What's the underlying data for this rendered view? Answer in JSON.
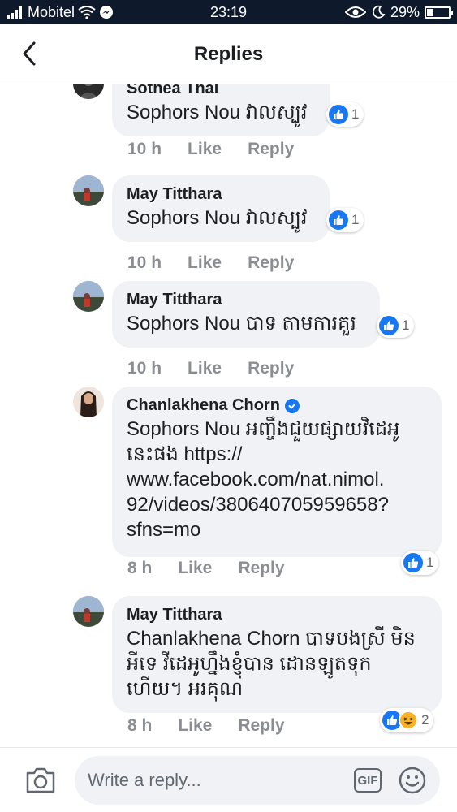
{
  "status_bar": {
    "carrier": "Mobitel",
    "time": "23:19",
    "battery": "29%",
    "battery_level": 0.29
  },
  "header": {
    "title": "Replies"
  },
  "comments": [
    {
      "author": "Sothea Thai",
      "text": "Sophors Nou វាលស្បូវ",
      "time": "10 h",
      "like_label": "Like",
      "reply_label": "Reply",
      "reaction_count": "1",
      "reactions": [
        "like-icon"
      ]
    },
    {
      "author": "May Titthara",
      "text": "Sophors Nou វាលស្បូវ",
      "time": "10 h",
      "like_label": "Like",
      "reply_label": "Reply",
      "reaction_count": "1",
      "reactions": [
        "like-icon"
      ]
    },
    {
      "author": "May Titthara",
      "text": "Sophors Nou បាទ តាមការគួរ",
      "time": "10 h",
      "like_label": "Like",
      "reply_label": "Reply",
      "reaction_count": "1",
      "reactions": [
        "like-icon"
      ]
    },
    {
      "author": "Chanlakhena Chorn",
      "verified": true,
      "text_lines": [
        "Sophors Nou  អញ្ចឹងជួយផ្សាយវិដេអូ",
        "នេះផង https://",
        "www.facebook.com/nat.nimol.",
        "92/videos/380640705959658?",
        "sfns=mo"
      ],
      "time": "8 h",
      "like_label": "Like",
      "reply_label": "Reply",
      "reaction_count": "1",
      "reactions": [
        "like-icon"
      ]
    },
    {
      "author": "May Titthara",
      "text_lines": [
        "Chanlakhena Chorn បាទបងស្រី មិន",
        "អីទេ វីដេអូហ្នឹងខ្ញុំបាន ដោនឡូតទុក",
        "ហើយ។ អរគុណ"
      ],
      "time": "8 h",
      "like_label": "Like",
      "reply_label": "Reply",
      "reaction_count": "2",
      "reactions": [
        "like-icon",
        "haha-icon"
      ]
    }
  ],
  "composer": {
    "placeholder": "Write a reply...",
    "gif_label": "GIF"
  },
  "colors": {
    "accent": "#1877f2",
    "status_bar": "#0e1a2b",
    "bubble": "#f0f2f5",
    "meta": "#8a8d91"
  }
}
